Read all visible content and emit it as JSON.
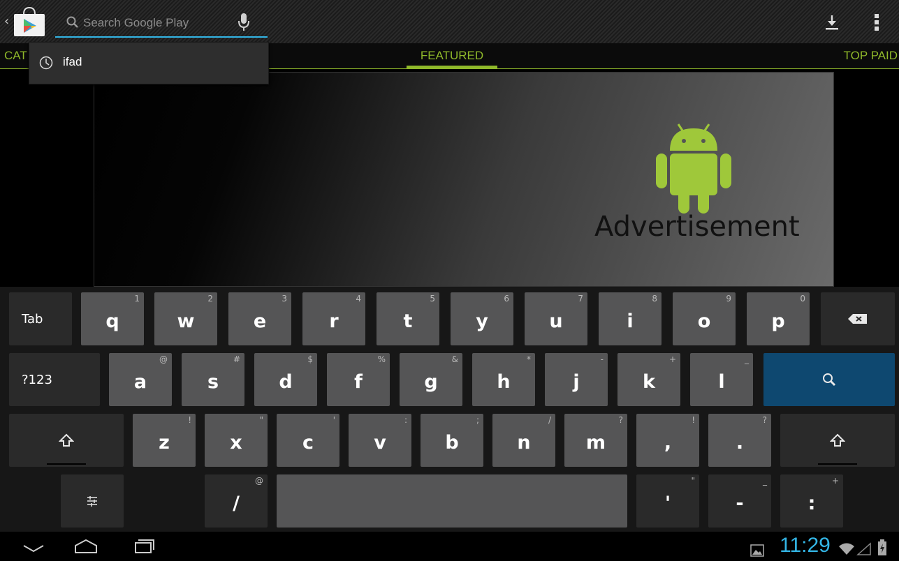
{
  "search": {
    "placeholder": "Search Google Play"
  },
  "tabs": {
    "left": "CAT",
    "featured": "FEATURED",
    "right": "TOP PAID"
  },
  "suggestion": {
    "text": "ifad"
  },
  "banner": {
    "text": "Advertisement"
  },
  "keyboard": {
    "row1": [
      {
        "main": "q",
        "hint": "1"
      },
      {
        "main": "w",
        "hint": "2"
      },
      {
        "main": "e",
        "hint": "3"
      },
      {
        "main": "r",
        "hint": "4"
      },
      {
        "main": "t",
        "hint": "5"
      },
      {
        "main": "y",
        "hint": "6"
      },
      {
        "main": "u",
        "hint": "7"
      },
      {
        "main": "i",
        "hint": "8"
      },
      {
        "main": "o",
        "hint": "9"
      },
      {
        "main": "p",
        "hint": "0"
      }
    ],
    "row2": [
      {
        "main": "a",
        "hint": "@"
      },
      {
        "main": "s",
        "hint": "#"
      },
      {
        "main": "d",
        "hint": "$"
      },
      {
        "main": "f",
        "hint": "%"
      },
      {
        "main": "g",
        "hint": "&"
      },
      {
        "main": "h",
        "hint": "*"
      },
      {
        "main": "j",
        "hint": "-"
      },
      {
        "main": "k",
        "hint": "+"
      },
      {
        "main": "l",
        "hint": "_"
      }
    ],
    "row3": [
      {
        "main": "z",
        "hint": "!"
      },
      {
        "main": "x",
        "hint": "\""
      },
      {
        "main": "c",
        "hint": "'"
      },
      {
        "main": "v",
        "hint": ":"
      },
      {
        "main": "b",
        "hint": ";"
      },
      {
        "main": "n",
        "hint": "/"
      },
      {
        "main": "m",
        "hint": "?"
      },
      {
        "main": ",",
        "hint": "!"
      },
      {
        "main": ".",
        "hint": "?"
      }
    ],
    "tab_label": "Tab",
    "symbols_label": "?123",
    "slash_key": {
      "main": "/",
      "hint": "@"
    },
    "apostrophe_key": {
      "main": "'",
      "hint": "\""
    },
    "dash_key": {
      "main": "-",
      "hint": "_"
    },
    "colon_key": {
      "main": ":",
      "hint": "+"
    }
  },
  "status": {
    "time": "11:29"
  },
  "colors": {
    "accent_blue": "#33b5e5",
    "tab_green": "#8fb82a",
    "android_green": "#9fc83a",
    "search_key": "#0e4870"
  }
}
